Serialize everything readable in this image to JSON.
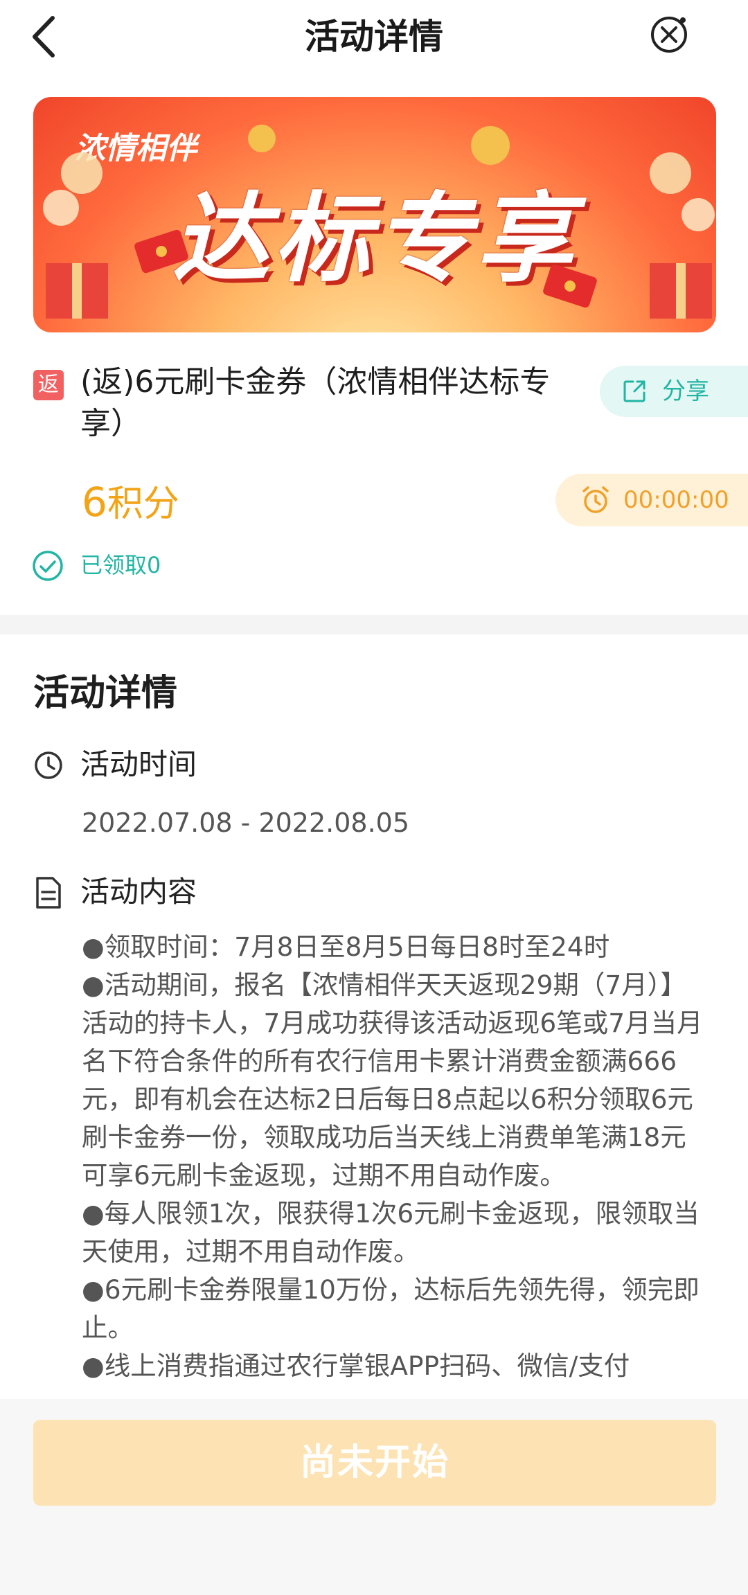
{
  "header": {
    "title": "活动详情"
  },
  "banner": {
    "brand": "浓情相伴",
    "headline": "达标专享"
  },
  "product": {
    "tag": "返",
    "title": "(返)6元刷卡金券（浓情相伴达标专享）",
    "share_label": "分享",
    "points_value": "6",
    "points_unit": "积分",
    "timer": "00:00:00",
    "claimed": "已领取0"
  },
  "details": {
    "section_title": "活动详情",
    "time_label": "活动时间",
    "time_value": "2022.07.08 - 2022.08.05",
    "content_label": "活动内容",
    "content_text": "●领取时间：7月8日至8月5日每日8时至24时\n●活动期间，报名【浓情相伴天天返现29期（7月）】活动的持卡人，7月成功获得该活动返现6笔或7月当月名下符合条件的所有农行信用卡累计消费金额满666元，即有机会在达标2日后每日8点起以6积分领取6元刷卡金券一份，领取成功后当天线上消费单笔满18元可享6元刷卡金返现，过期不用自动作废。\n●每人限领1次，限获得1次6元刷卡金返现，限领取当天使用，过期不用自动作废。\n●6元刷卡金券限量10万份，达标后先领先得，领完即止。\n●线上消费指通过农行掌银APP扫码、微信/支付"
  },
  "footer": {
    "button_label": "尚未开始"
  },
  "colors": {
    "teal": "#21b5a3",
    "orange": "#f3a316",
    "button_bg": "#fde3b3"
  }
}
